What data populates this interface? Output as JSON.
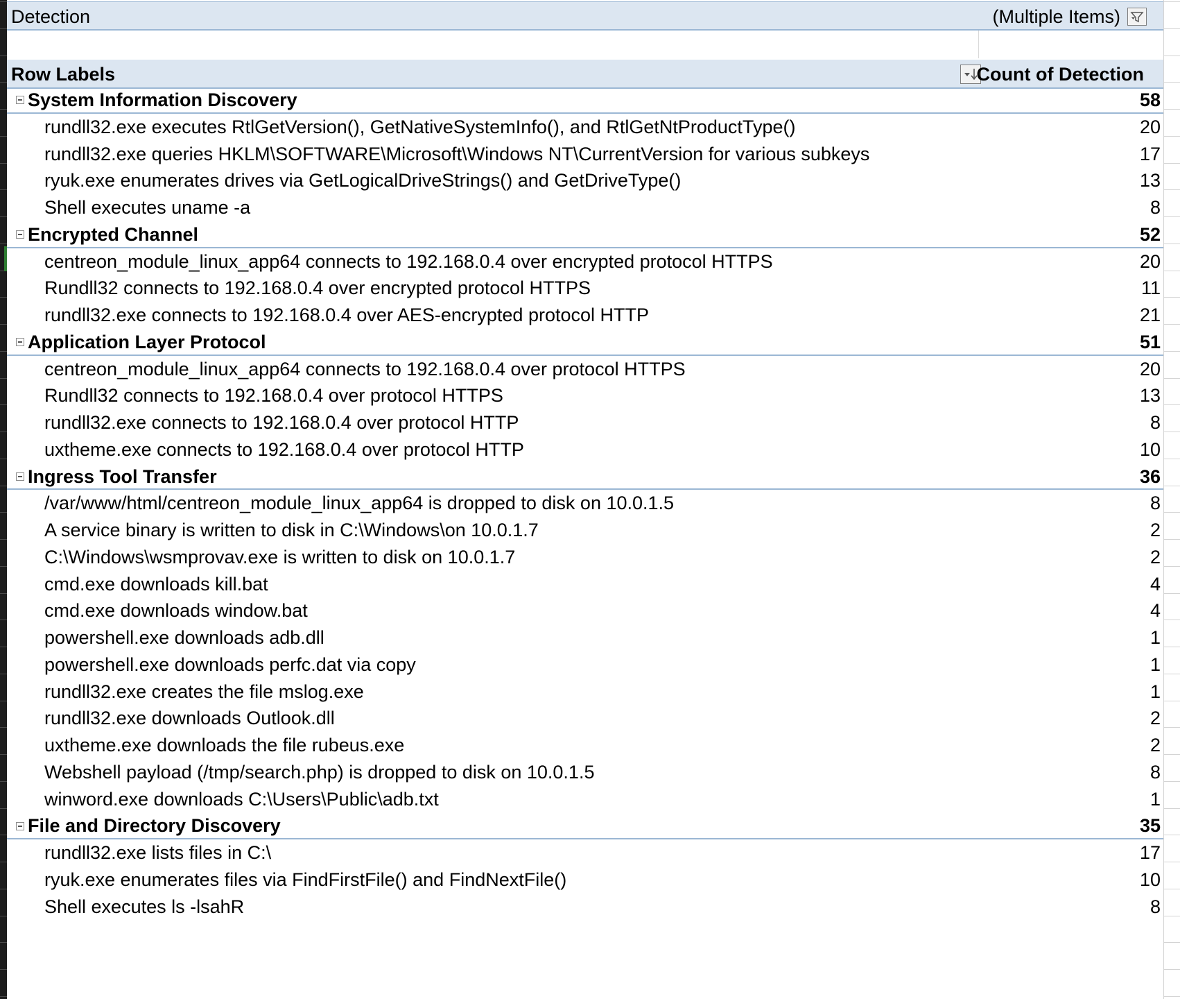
{
  "filter": {
    "field": "Detection",
    "value": "(Multiple Items)",
    "icon": "filter-dropdown-icon"
  },
  "header": {
    "row_labels": "Row Labels",
    "count_label": "Count of Detection",
    "sort_icon": "sort-dropdown-icon"
  },
  "groups": [
    {
      "name": "System Information Discovery",
      "total": "58",
      "items": [
        {
          "label": "rundll32.exe executes RtlGetVersion(), GetNativeSystemInfo(), and RtlGetNtProductType()",
          "count": "20"
        },
        {
          "label": "rundll32.exe queries HKLM\\SOFTWARE\\Microsoft\\Windows NT\\CurrentVersion for various subkeys",
          "count": "17"
        },
        {
          "label": "ryuk.exe enumerates drives via GetLogicalDriveStrings() and GetDriveType()",
          "count": "13"
        },
        {
          "label": "Shell executes uname -a",
          "count": "8"
        }
      ]
    },
    {
      "name": "Encrypted Channel",
      "total": "52",
      "items": [
        {
          "label": "centreon_module_linux_app64 connects to 192.168.0.4 over encrypted protocol HTTPS",
          "count": "20"
        },
        {
          "label": "Rundll32 connects to 192.168.0.4 over encrypted protocol HTTPS",
          "count": "11"
        },
        {
          "label": "rundll32.exe connects to 192.168.0.4 over AES-encrypted protocol HTTP",
          "count": "21"
        }
      ]
    },
    {
      "name": "Application Layer Protocol",
      "total": "51",
      "items": [
        {
          "label": "centreon_module_linux_app64 connects to 192.168.0.4 over protocol HTTPS",
          "count": "20"
        },
        {
          "label": "Rundll32 connects to 192.168.0.4 over protocol HTTPS",
          "count": "13"
        },
        {
          "label": "rundll32.exe connects to 192.168.0.4 over protocol HTTP",
          "count": "8"
        },
        {
          "label": "uxtheme.exe connects to 192.168.0.4 over protocol HTTP",
          "count": "10"
        }
      ]
    },
    {
      "name": "Ingress Tool Transfer",
      "total": "36",
      "items": [
        {
          "label": "/var/www/html/centreon_module_linux_app64 is dropped to disk on 10.0.1.5",
          "count": "8"
        },
        {
          "label": "A service binary is written to disk in C:\\Windows\\on 10.0.1.7",
          "count": "2"
        },
        {
          "label": "C:\\Windows\\wsmprovav.exe is written to disk on 10.0.1.7",
          "count": "2"
        },
        {
          "label": "cmd.exe downloads kill.bat",
          "count": "4"
        },
        {
          "label": "cmd.exe downloads window.bat",
          "count": "4"
        },
        {
          "label": "powershell.exe downloads adb.dll",
          "count": "1"
        },
        {
          "label": "powershell.exe downloads perfc.dat via copy",
          "count": "1"
        },
        {
          "label": "rundll32.exe creates the file mslog.exe",
          "count": "1"
        },
        {
          "label": "rundll32.exe downloads Outlook.dll",
          "count": "2"
        },
        {
          "label": "uxtheme.exe downloads  the file rubeus.exe",
          "count": "2"
        },
        {
          "label": "Webshell payload (/tmp/search.php) is dropped to disk on 10.0.1.5",
          "count": "8"
        },
        {
          "label": "winword.exe downloads C:\\Users\\Public\\adb.txt",
          "count": "1"
        }
      ]
    },
    {
      "name": "File and Directory Discovery",
      "total": "35",
      "items": [
        {
          "label": "rundll32.exe lists files in C:\\",
          "count": "17"
        },
        {
          "label": "ryuk.exe enumerates files via FindFirstFile() and FindNextFile()",
          "count": "10"
        },
        {
          "label": "Shell executes ls -lsahR",
          "count": "8"
        }
      ]
    }
  ],
  "colors": {
    "header_fill": "#dce6f1",
    "border": "#9bb7d4"
  }
}
